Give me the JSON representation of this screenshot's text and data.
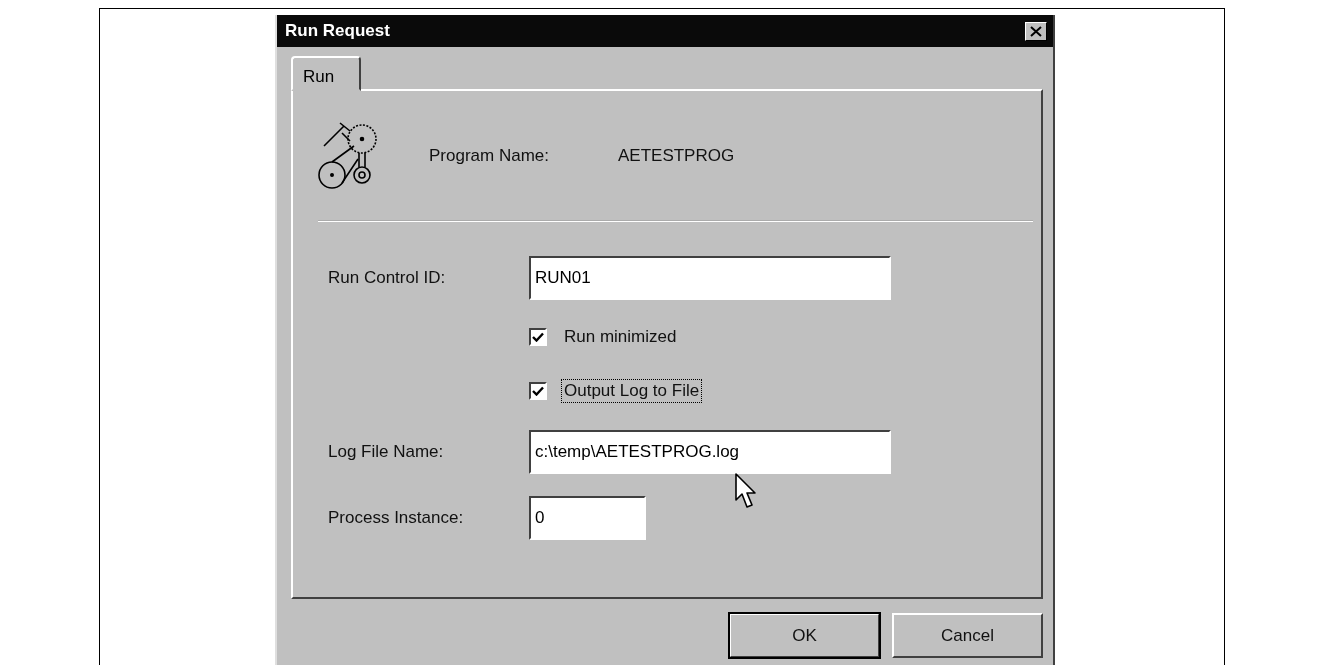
{
  "window": {
    "title": "Run Request"
  },
  "tabs": [
    {
      "label": "Run",
      "selected": true
    }
  ],
  "program": {
    "label": "Program Name:",
    "value": "AETESTPROG"
  },
  "fields": [
    {
      "kind": "text",
      "label": "Run Control ID:",
      "value": "RUN01"
    },
    {
      "kind": "checkbox",
      "label": "Run minimized",
      "checked": true,
      "focused": false
    },
    {
      "kind": "checkbox",
      "label": "Output Log to File",
      "checked": true,
      "focused": true
    },
    {
      "kind": "text",
      "label": "Log File Name:",
      "value": "c:\\temp\\AETESTPROG.log"
    },
    {
      "kind": "short_text",
      "label": "Process Instance:",
      "value": "0"
    }
  ],
  "buttons": [
    {
      "label": "OK",
      "default": true
    },
    {
      "label": "Cancel",
      "default": false
    }
  ]
}
